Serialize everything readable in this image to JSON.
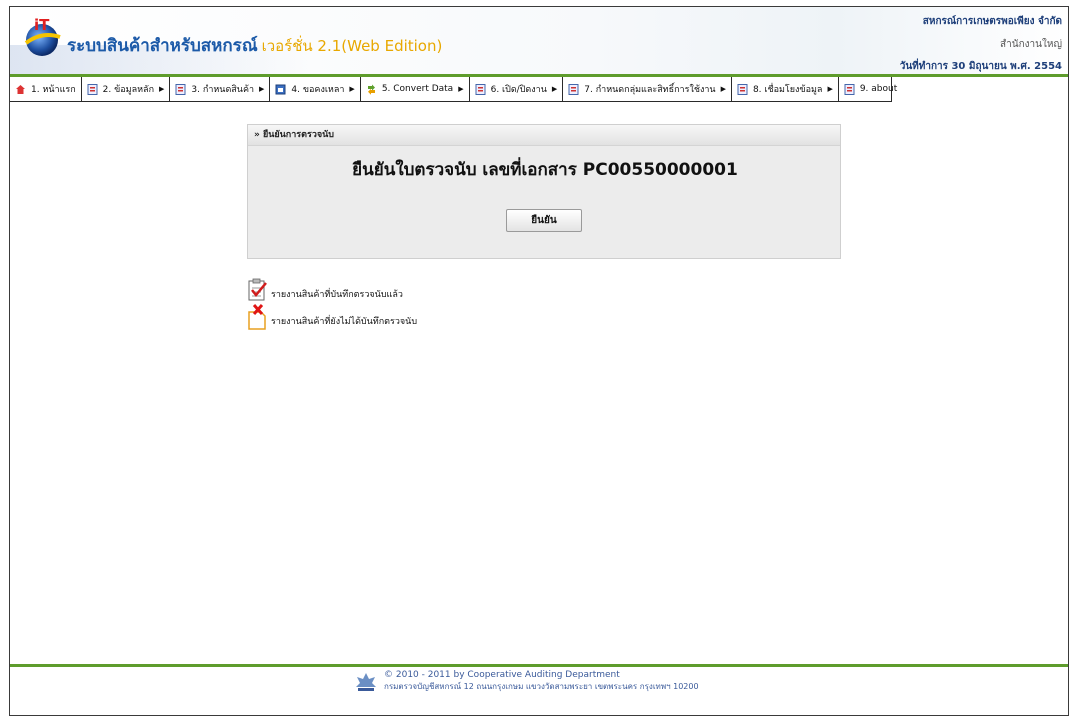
{
  "header": {
    "app_title": "ระบบสินค้าสำหรับสหกรณ์",
    "app_version": "เวอร์ชั่น 2.1(Web Edition)",
    "org_name": "สหกรณ์การเกษตรพอเพียง จำกัด",
    "branch": "สำนักงานใหญ่",
    "date": "วันที่ทำการ 30 มิถุนายน พ.ศ. 2554"
  },
  "menu": {
    "items": [
      {
        "label": "1. หน้าแรก",
        "icon": "home-icon",
        "has_arrow": false
      },
      {
        "label": "2. ข้อมูลหลัก",
        "icon": "form-icon",
        "has_arrow": true
      },
      {
        "label": "3. กำหนดสินค้า",
        "icon": "form-icon",
        "has_arrow": true
      },
      {
        "label": "4. ขอคงเหลา",
        "icon": "calendar-icon",
        "has_arrow": true
      },
      {
        "label": "5. Convert Data",
        "icon": "convert-icon",
        "has_arrow": true
      },
      {
        "label": "6. เปิด/ปิดงาน",
        "icon": "form-icon",
        "has_arrow": true
      },
      {
        "label": "7. กำหนดกลุ่มและสิทธิ์การใช้งาน",
        "icon": "form-icon",
        "has_arrow": true
      },
      {
        "label": "8. เชื่อมโยงข้อมูล",
        "icon": "form-icon",
        "has_arrow": true
      },
      {
        "label": "9. about",
        "icon": "form-icon",
        "has_arrow": false
      }
    ]
  },
  "panel": {
    "header": "» ยืนยันการตรวจนับ",
    "title": "ยืนยันใบตรวจนับ เลขที่เอกสาร PC00550000001",
    "button": "ยืนยัน"
  },
  "reports": [
    {
      "label": "รายงานสินค้าที่บันทึกตรวจนับแล้ว",
      "icon": "checklist-icon"
    },
    {
      "label": "รายงานสินค้าที่ยังไม่ได้บันทึกตรวจนับ",
      "icon": "document-x-icon"
    }
  ],
  "footer": {
    "copyright": "© 2010 - 2011  by Cooperative Auditing Department",
    "address": "กรมตรวจบัญชีสหกรณ์ 12 ถนนกรุงเกษม แขวงวัดสามพระยา เขตพระนคร กรุงเทพฯ 10200"
  },
  "colors": {
    "accent_green": "#5e9c2c",
    "title_blue": "#1c5aa8",
    "version_yellow": "#e8a800"
  }
}
